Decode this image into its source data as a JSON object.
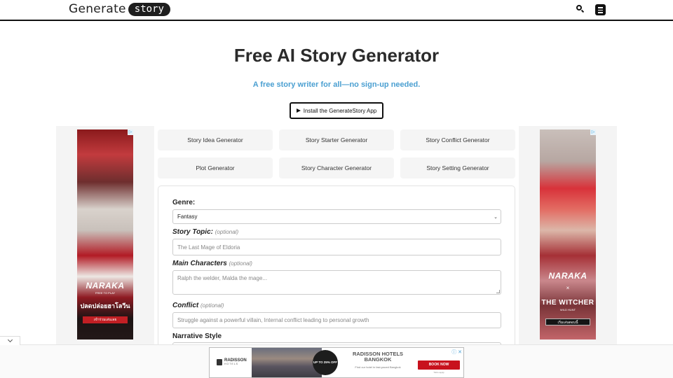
{
  "header": {
    "logo_text": "Generate",
    "logo_pill": "story",
    "search_icon": "search-icon",
    "menu_icon": "menu-icon"
  },
  "hero": {
    "title": "Free AI Story Generator",
    "subtitle": "A free story writer for all—no sign-up needed.",
    "install_button": "Install the GenerateStory App",
    "install_icon": "play-store-icon"
  },
  "generators": [
    {
      "label": "Story Idea Generator"
    },
    {
      "label": "Story Starter Generator"
    },
    {
      "label": "Story Conflict Generator"
    },
    {
      "label": "Plot Generator"
    },
    {
      "label": "Story Character Generator"
    },
    {
      "label": "Story Setting Generator"
    }
  ],
  "form": {
    "genre": {
      "label": "Genre:",
      "value": "Fantasy"
    },
    "topic": {
      "label": "Story Topic:",
      "optional": "(optional)",
      "placeholder": "The Last Mage of Eldoria"
    },
    "characters": {
      "label": "Main Characters",
      "optional": "(optional)",
      "placeholder": "Ralph the welder, Malda the mage..."
    },
    "conflict": {
      "label": "Conflict",
      "optional": "(optional)",
      "placeholder": "Struggle against a powerful villain, Internal conflict leading to personal growth"
    },
    "narrative_style": {
      "label": "Narrative Style"
    }
  },
  "ads": {
    "left": {
      "brand": "NARAKA",
      "tag": "FREE TO PLAY",
      "headline": "ปลดปล่อยฮาโลวีน",
      "cta": "เข้าร่วมเล่นเลย"
    },
    "right": {
      "brand": "NARAKA",
      "x": "×",
      "collab": "THE WITCHER",
      "collab_sub": "WILD HUNT",
      "cta": "เริ่มเล่นตอนนี้"
    },
    "bottom": {
      "logo_name": "RADISSON",
      "logo_sub": "HOTELS",
      "badge": "UP TO 25% OFF",
      "headline": "RADISSON HOTELS BANGKOK",
      "tagline": "Find our hotel in fast-paced Bangkok",
      "cta": "BOOK NOW",
      "terms": "T&Cs apply"
    }
  },
  "colors": {
    "accent": "#4a9fd1",
    "ad_cta_red": "#c8121d"
  }
}
